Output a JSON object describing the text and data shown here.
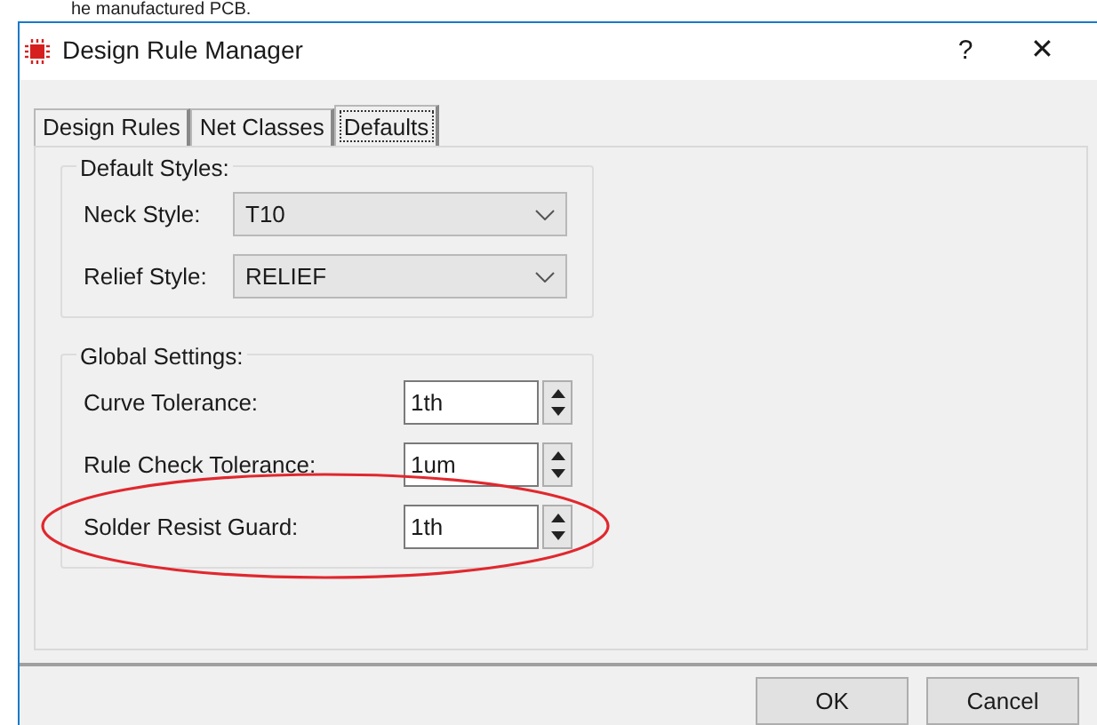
{
  "caption": "he manufactured PCB.",
  "window": {
    "title": "Design Rule Manager",
    "help": "?",
    "close": "✕"
  },
  "tabs": [
    {
      "label": "Design Rules",
      "selected": false
    },
    {
      "label": "Net Classes",
      "selected": false
    },
    {
      "label": "Defaults",
      "selected": true
    }
  ],
  "default_styles": {
    "title": "Default Styles:",
    "fields": [
      {
        "label": "Neck Style:",
        "value": "T10"
      },
      {
        "label": "Relief Style:",
        "value": "RELIEF"
      }
    ]
  },
  "global_settings": {
    "title": "Global Settings:",
    "fields": [
      {
        "label": "Curve Tolerance:",
        "value": "1th",
        "highlighted": false
      },
      {
        "label": "Rule Check Tolerance:",
        "value": "1um",
        "highlighted": false
      },
      {
        "label": "Solder Resist Guard:",
        "value": "1th",
        "highlighted": true
      }
    ]
  },
  "buttons": [
    "OK",
    "Cancel"
  ]
}
